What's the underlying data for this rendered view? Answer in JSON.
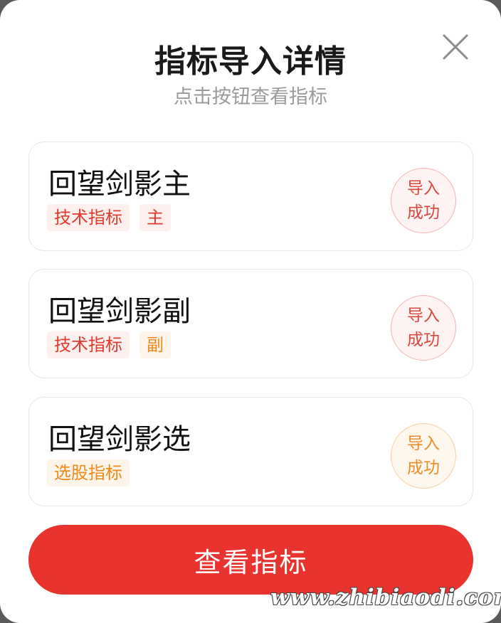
{
  "header": {
    "title": "指标导入详情",
    "subtitle": "点击按钮查看指标",
    "close_icon": "close-icon"
  },
  "items": [
    {
      "name": "回望剑影主",
      "tags": [
        {
          "label": "技术指标",
          "color": "#e23b2f"
        },
        {
          "label": "主",
          "color": "#e23b2f"
        }
      ],
      "status_line1": "导入",
      "status_line2": "成功",
      "status_color": "#d9473d"
    },
    {
      "name": "回望剑影副",
      "tags": [
        {
          "label": "技术指标",
          "color": "#e23b2f"
        },
        {
          "label": "副",
          "color": "#f08a1c"
        }
      ],
      "status_line1": "导入",
      "status_line2": "成功",
      "status_color": "#d9473d"
    },
    {
      "name": "回望剑影选",
      "tags": [
        {
          "label": "选股指标",
          "color": "#f08a1c"
        }
      ],
      "status_line1": "导入",
      "status_line2": "成功",
      "status_color": "#ec8d27"
    }
  ],
  "primary_button": {
    "label": "查看指标",
    "color": "#e8332e"
  },
  "watermark": "www.zhibiaodi.com"
}
